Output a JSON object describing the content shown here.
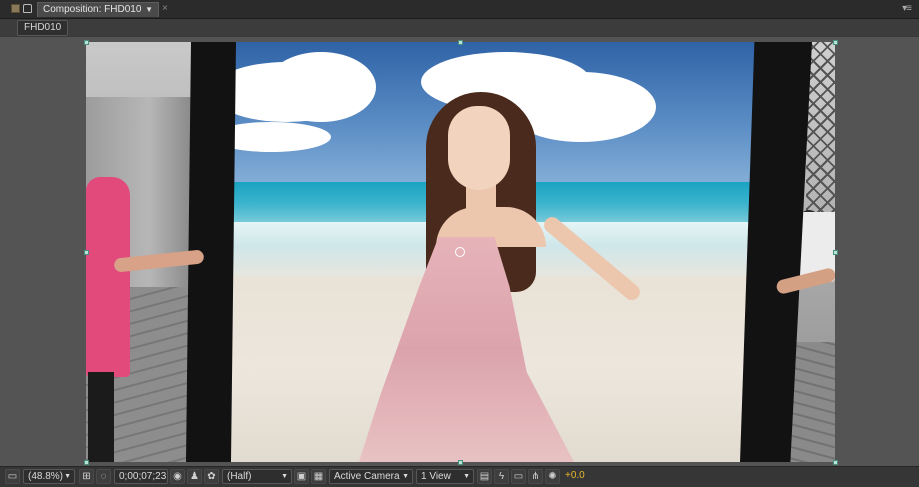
{
  "tab": {
    "title": "Composition: FHD010",
    "dropdown_icon": "triangle-down-icon",
    "close_icon": "close-icon"
  },
  "breadcrumb": {
    "label": "FHD010"
  },
  "panel_menu_icon": "panel-menu-icon",
  "viewer": {
    "content": "photo"
  },
  "toolbar": {
    "magnification": "(48.8%)",
    "timecode": "0;00;07;23",
    "resolution": "(Half)",
    "camera": "Active Camera",
    "views": "1 View",
    "exposure": "+0.0"
  },
  "colors": {
    "exposure": "#e5b72b",
    "handle": "#b8e4d8"
  }
}
